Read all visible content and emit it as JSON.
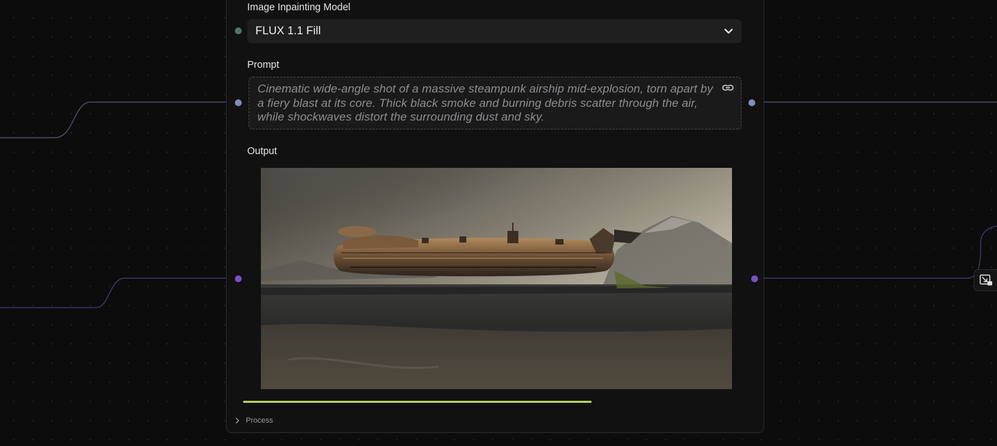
{
  "node": {
    "model_field": {
      "label": "Image Inpainting Model",
      "selected": "FLUX 1.1 Fill",
      "icon": "chevron-down-icon"
    },
    "prompt_field": {
      "label": "Prompt",
      "value": "Cinematic wide-angle shot of a massive steampunk airship mid-explosion, torn apart by a fiery blast at its core. Thick black smoke and burning debris scatter through the air, while shockwaves distort the surrounding dust and sky.",
      "icon": "link-icon"
    },
    "output_field": {
      "label": "Output",
      "image": "steampunk airship over barren plain"
    },
    "progress": {
      "fraction": 0.69,
      "color": "#b9d15f"
    },
    "process": {
      "label": "Process",
      "icon": "chevron-right-icon"
    }
  },
  "colors": {
    "model_handle": "#4f7563",
    "prompt_handle": "#7f8fb8",
    "image_handle": "#7b4fc4",
    "wire_prompt": "#55596e",
    "wire_image": "#4a3a78"
  },
  "side_button": {
    "icon": "expand-image-icon"
  }
}
